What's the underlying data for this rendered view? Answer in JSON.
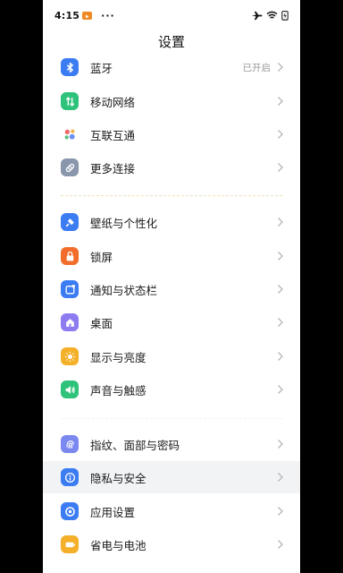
{
  "status_bar": {
    "time": "4:15",
    "app_notification_color": "#f08a24",
    "more_indicator": "···",
    "icons": [
      "airplane-icon",
      "wifi-icon",
      "battery-charging-icon"
    ]
  },
  "page": {
    "title": "设置"
  },
  "colors": {
    "blue": "#3c7cf2",
    "green": "#2fc27a",
    "gray": "#8a96ac",
    "orange": "#f26d2c",
    "purple": "#8d7cf0",
    "yellow": "#f5b02a",
    "indigo": "#7b88f0"
  },
  "groups": [
    {
      "items": [
        {
          "id": "bluetooth",
          "label": "蓝牙",
          "value": "已开启",
          "icon": "bluetooth-icon"
        },
        {
          "id": "mobile-network",
          "label": "移动网络",
          "icon": "mobile-data-icon"
        },
        {
          "id": "interconnect",
          "label": "互联互通",
          "icon": "interconnect-icon"
        },
        {
          "id": "more-connections",
          "label": "更多连接",
          "icon": "link-icon"
        }
      ]
    },
    {
      "items": [
        {
          "id": "wallpaper",
          "label": "壁纸与个性化",
          "icon": "paint-brush-icon"
        },
        {
          "id": "lock-screen",
          "label": "锁屏",
          "icon": "lock-icon"
        },
        {
          "id": "notifications",
          "label": "通知与状态栏",
          "icon": "notification-icon"
        },
        {
          "id": "desktop",
          "label": "桌面",
          "icon": "home-icon"
        },
        {
          "id": "display",
          "label": "显示与亮度",
          "icon": "sun-icon"
        },
        {
          "id": "sound",
          "label": "声音与触感",
          "icon": "speaker-icon"
        }
      ]
    },
    {
      "items": [
        {
          "id": "biometrics",
          "label": "指纹、面部与密码",
          "icon": "fingerprint-icon"
        },
        {
          "id": "privacy",
          "label": "隐私与安全",
          "icon": "privacy-icon"
        },
        {
          "id": "apps",
          "label": "应用设置",
          "icon": "app-settings-icon"
        },
        {
          "id": "battery",
          "label": "省电与电池",
          "icon": "battery-icon"
        }
      ]
    }
  ]
}
